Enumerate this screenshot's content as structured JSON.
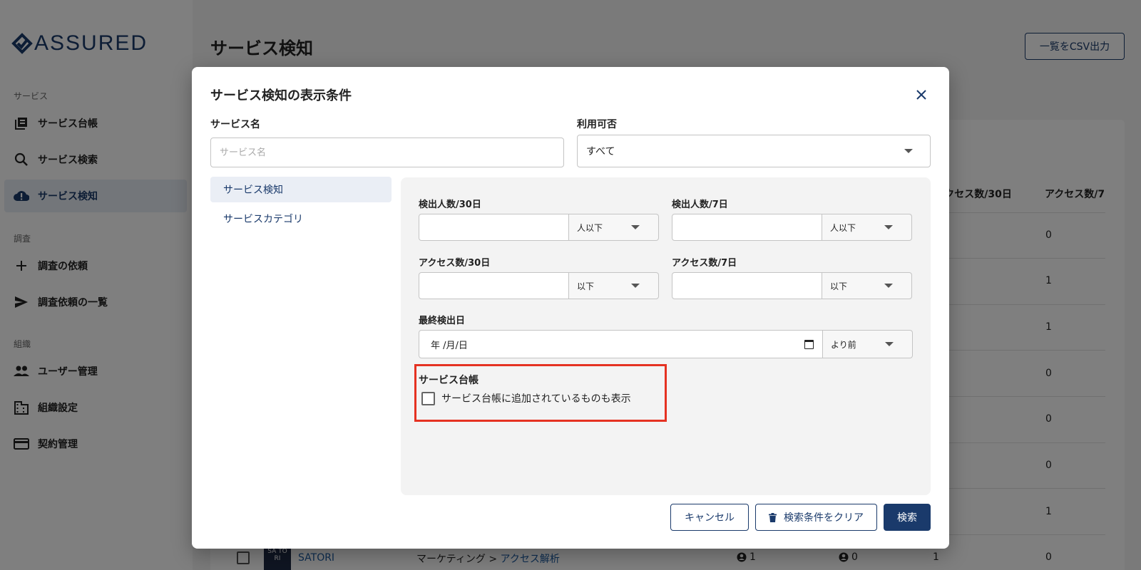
{
  "app": {
    "logo_text": "ASSURED",
    "page_title": "サービス検知",
    "csv_button": "一覧をCSV出力"
  },
  "sidebar": {
    "sections": [
      {
        "label": "サービス"
      },
      {
        "label": "調査"
      },
      {
        "label": "組織"
      }
    ],
    "items": [
      {
        "label": "サービス台帳",
        "icon": "library-icon"
      },
      {
        "label": "サービス検索",
        "icon": "search-icon"
      },
      {
        "label": "サービス検知",
        "icon": "cloud-alert-icon",
        "active": true
      },
      {
        "label": "調査の依頼",
        "icon": "plus-icon"
      },
      {
        "label": "調査依頼の一覧",
        "icon": "send-icon"
      },
      {
        "label": "ユーザー管理",
        "icon": "people-icon"
      },
      {
        "label": "組織設定",
        "icon": "building-icon"
      },
      {
        "label": "契約管理",
        "icon": "credit-card-icon"
      }
    ]
  },
  "table": {
    "headers": [
      "アクセス数/30日",
      "アクセス数/7"
    ],
    "access_col_values": [
      "0",
      "1",
      "1",
      "0",
      "0",
      "0",
      "1",
      "0"
    ],
    "last_row": {
      "logo_text": "SA TO RI",
      "service": "SATORI",
      "category_prefix": "マーケティング > ",
      "category_link": "アクセス解析",
      "users_30": "1",
      "users_7": "0",
      "access_30": "1",
      "access_7": "0"
    }
  },
  "modal": {
    "title": "サービス検知の表示条件",
    "service_name": {
      "label": "サービス名",
      "placeholder": "サービス名",
      "value": ""
    },
    "availability": {
      "label": "利用可否",
      "value": "すべて"
    },
    "tabs": [
      {
        "label": "サービス検知",
        "active": true
      },
      {
        "label": "サービスカテゴリ",
        "active": false
      }
    ],
    "filters": {
      "detect_30": {
        "label": "検出人数/30日",
        "value": "",
        "op": "人以下"
      },
      "detect_7": {
        "label": "検出人数/7日",
        "value": "",
        "op": "人以下"
      },
      "access_30": {
        "label": "アクセス数/30日",
        "value": "",
        "op": "以下"
      },
      "access_7": {
        "label": "アクセス数/7日",
        "value": "",
        "op": "以下"
      },
      "last_detected": {
        "label": "最終検出日",
        "value": "年 /月/日",
        "op": "より前"
      },
      "ledger": {
        "label": "サービス台帳",
        "checkbox_label": "サービス台帳に追加されているものも表示",
        "checked": false
      }
    },
    "buttons": {
      "cancel": "キャンセル",
      "clear": "検索条件をクリア",
      "search": "検索"
    }
  },
  "colors": {
    "brand": "#1a3a6b",
    "highlight": "#e53222",
    "link": "#1a5aa0"
  }
}
